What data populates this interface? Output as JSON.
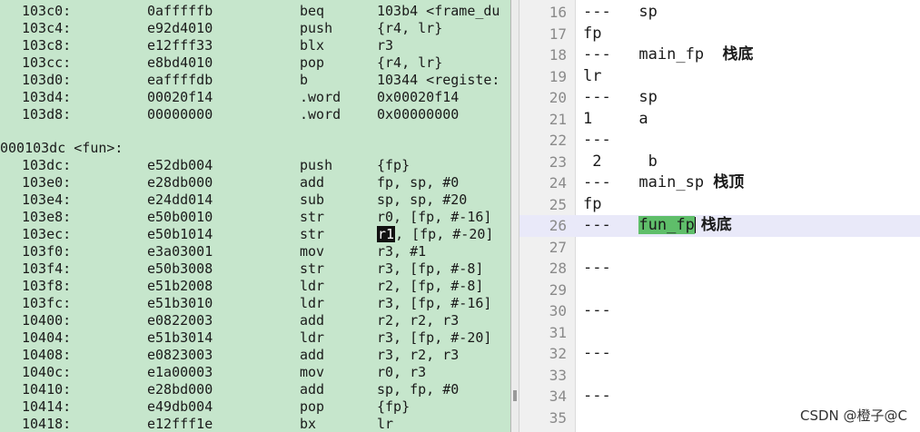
{
  "disassembly": {
    "rows_top": [
      {
        "addr": "103c0:",
        "hex": "0afffffb",
        "mnemonic": "beq",
        "operands": "103b4 <frame_du"
      },
      {
        "addr": "103c4:",
        "hex": "e92d4010",
        "mnemonic": "push",
        "operands": "{r4, lr}"
      },
      {
        "addr": "103c8:",
        "hex": "e12fff33",
        "mnemonic": "blx",
        "operands": "r3"
      },
      {
        "addr": "103cc:",
        "hex": "e8bd4010",
        "mnemonic": "pop",
        "operands": "{r4, lr}"
      },
      {
        "addr": "103d0:",
        "hex": "eaffffdb",
        "mnemonic": "b",
        "operands": "10344 <registe:"
      },
      {
        "addr": "103d4:",
        "hex": "00020f14",
        "mnemonic": ".word",
        "operands": "0x00020f14"
      },
      {
        "addr": "103d8:",
        "hex": "00000000",
        "mnemonic": ".word",
        "operands": "0x00000000"
      }
    ],
    "fun_label": "000103dc <fun>:",
    "rows_fun": [
      {
        "addr": "103dc:",
        "hex": "e52db004",
        "mnemonic": "push",
        "operands": "{fp}"
      },
      {
        "addr": "103e0:",
        "hex": "e28db000",
        "mnemonic": "add",
        "operands": "fp, sp, #0"
      },
      {
        "addr": "103e4:",
        "hex": "e24dd014",
        "mnemonic": "sub",
        "operands": "sp, sp, #20"
      },
      {
        "addr": "103e8:",
        "hex": "e50b0010",
        "mnemonic": "str",
        "operands": "r0, [fp, #-16]"
      },
      {
        "addr": "103ec:",
        "hex": "e50b1014",
        "mnemonic": "str",
        "operands_hl": "r1",
        "operands_rest": ", [fp, #-20]"
      },
      {
        "addr": "103f0:",
        "hex": "e3a03001",
        "mnemonic": "mov",
        "operands": "r3, #1"
      },
      {
        "addr": "103f4:",
        "hex": "e50b3008",
        "mnemonic": "str",
        "operands": "r3, [fp, #-8]"
      },
      {
        "addr": "103f8:",
        "hex": "e51b2008",
        "mnemonic": "ldr",
        "operands": "r2, [fp, #-8]"
      },
      {
        "addr": "103fc:",
        "hex": "e51b3010",
        "mnemonic": "ldr",
        "operands": "r3, [fp, #-16]"
      },
      {
        "addr": "10400:",
        "hex": "e0822003",
        "mnemonic": "add",
        "operands": "r2, r2, r3"
      },
      {
        "addr": "10404:",
        "hex": "e51b3014",
        "mnemonic": "ldr",
        "operands": "r3, [fp, #-20]"
      },
      {
        "addr": "10408:",
        "hex": "e0823003",
        "mnemonic": "add",
        "operands": "r3, r2, r3"
      },
      {
        "addr": "1040c:",
        "hex": "e1a00003",
        "mnemonic": "mov",
        "operands": "r0, r3"
      },
      {
        "addr": "10410:",
        "hex": "e28bd000",
        "mnemonic": "add",
        "operands": "sp, fp, #0"
      },
      {
        "addr": "10414:",
        "hex": "e49db004",
        "mnemonic": "pop",
        "operands": "{fp}"
      },
      {
        "addr": "10418:",
        "hex": "e12fff1e",
        "mnemonic": "bx",
        "operands": "lr"
      }
    ]
  },
  "editor": {
    "lines": [
      {
        "num": "16",
        "text": "---   sp"
      },
      {
        "num": "17",
        "text": "fp"
      },
      {
        "num": "18",
        "text": "---   main_fp  ",
        "cjk": "栈底"
      },
      {
        "num": "19",
        "text": "lr"
      },
      {
        "num": "20",
        "text": "---   sp"
      },
      {
        "num": "21",
        "text": "1     a"
      },
      {
        "num": "22",
        "text": "---"
      },
      {
        "num": "23",
        "text": " 2     b"
      },
      {
        "num": "24",
        "text": "---   main_sp ",
        "cjk": "栈顶"
      },
      {
        "num": "25",
        "text": "fp"
      },
      {
        "num": "26",
        "text": "---   ",
        "sel": "fun_fp",
        "cjk": " 栈底"
      },
      {
        "num": "27",
        "text": ""
      },
      {
        "num": "28",
        "text": "---"
      },
      {
        "num": "29",
        "text": ""
      },
      {
        "num": "30",
        "text": "---"
      },
      {
        "num": "31",
        "text": ""
      },
      {
        "num": "32",
        "text": "---"
      },
      {
        "num": "33",
        "text": ""
      },
      {
        "num": "34",
        "text": "---"
      },
      {
        "num": "35",
        "text": ""
      }
    ]
  },
  "watermark": "CSDN @橙子@C"
}
